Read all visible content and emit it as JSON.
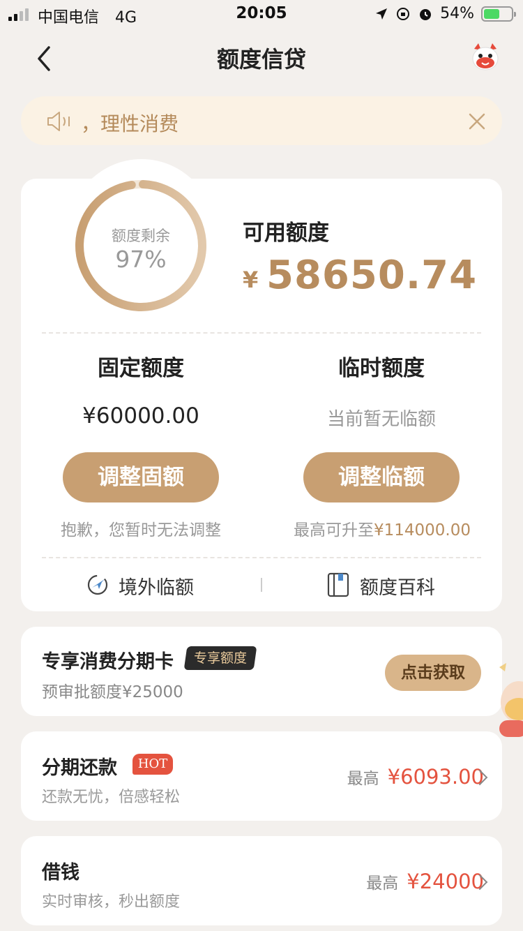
{
  "status_bar": {
    "carrier": "中国电信",
    "network": "4G",
    "time": "20:05",
    "battery": "54%"
  },
  "nav": {
    "title": "额度信贷",
    "back_icon": "chevron-left-icon",
    "mascot_icon": "mascot-icon"
  },
  "notice": {
    "text": "，理性消费",
    "speaker_icon": "speaker-icon",
    "close_icon": "close-icon"
  },
  "credit": {
    "ring_label": "额度剩余",
    "ring_percent": "97%",
    "ring_fraction": 0.97,
    "available_label": "可用额度",
    "currency": "¥",
    "available_value": "58650.74",
    "fixed": {
      "title": "固定额度",
      "amount": "¥60000.00",
      "button": "调整固额",
      "note": "抱歉，您暂时无法调整"
    },
    "temporary": {
      "title": "临时额度",
      "status": "当前暂无临额",
      "button": "调整临额",
      "note_prefix": "最高可升至",
      "note_amount": "¥114000.00"
    },
    "links": [
      {
        "label": "境外临额",
        "icon": "airplane-globe-icon"
      },
      {
        "label": "额度百科",
        "icon": "book-icon"
      }
    ]
  },
  "installment_card": {
    "title": "专享消费分期卡",
    "badge": "专享额度",
    "subtitle": "预审批额度¥25000",
    "button": "点击获取"
  },
  "repay": {
    "title": "分期还款",
    "badge": "HOT",
    "subtitle": "还款无忧，倍感轻松",
    "max_label": "最高",
    "max_value": "¥6093.00"
  },
  "borrow": {
    "title": "借钱",
    "subtitle": "实时审核，秒出额度",
    "max_label": "最高",
    "max_value": "¥24000"
  },
  "colors": {
    "accent": "#c89f72",
    "accent_text": "#b78c5e",
    "highlight_red": "#e4533f",
    "background": "#f3f0ed"
  }
}
